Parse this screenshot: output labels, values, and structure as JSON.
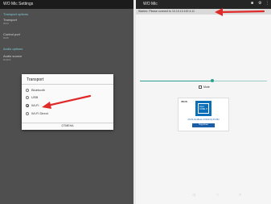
{
  "left": {
    "app_title": "WO Mic Settings",
    "sections": [
      {
        "header": "Transport options",
        "items": [
          {
            "label": "Transport",
            "value": "Wi-Fi"
          },
          {
            "label": "Control port",
            "value": "8125"
          }
        ]
      },
      {
        "header": "Audio options",
        "items": [
          {
            "label": "Audio source",
            "value": "Default"
          }
        ]
      }
    ]
  },
  "dialog": {
    "title": "Transport",
    "options": [
      "Bluetooth",
      "USB",
      "Wi-Fi",
      "Wi-Fi Direct"
    ],
    "selected": "Wi-Fi",
    "cancel_label": "ОТМЕНА"
  },
  "right": {
    "app_title": "WO Mic",
    "status_text": "Started. Please connect to 10.10.10.100 4:11",
    "volume_level": 0.57,
    "mute_label": "Mute",
    "ad": {
      "brand": "/ISUS",
      "chip_brand": "intel",
      "chip_line": "CORE i7",
      "headline": "ASUS ZenBook UX310UQ-FC352",
      "button_label": "Подробнее"
    }
  },
  "colors": {
    "left_bg": "#4f4f4f",
    "accent_teal": "#2ba08f",
    "annotation_arrow": "#e02a2a",
    "intel_blue": "#0a6fb8"
  }
}
